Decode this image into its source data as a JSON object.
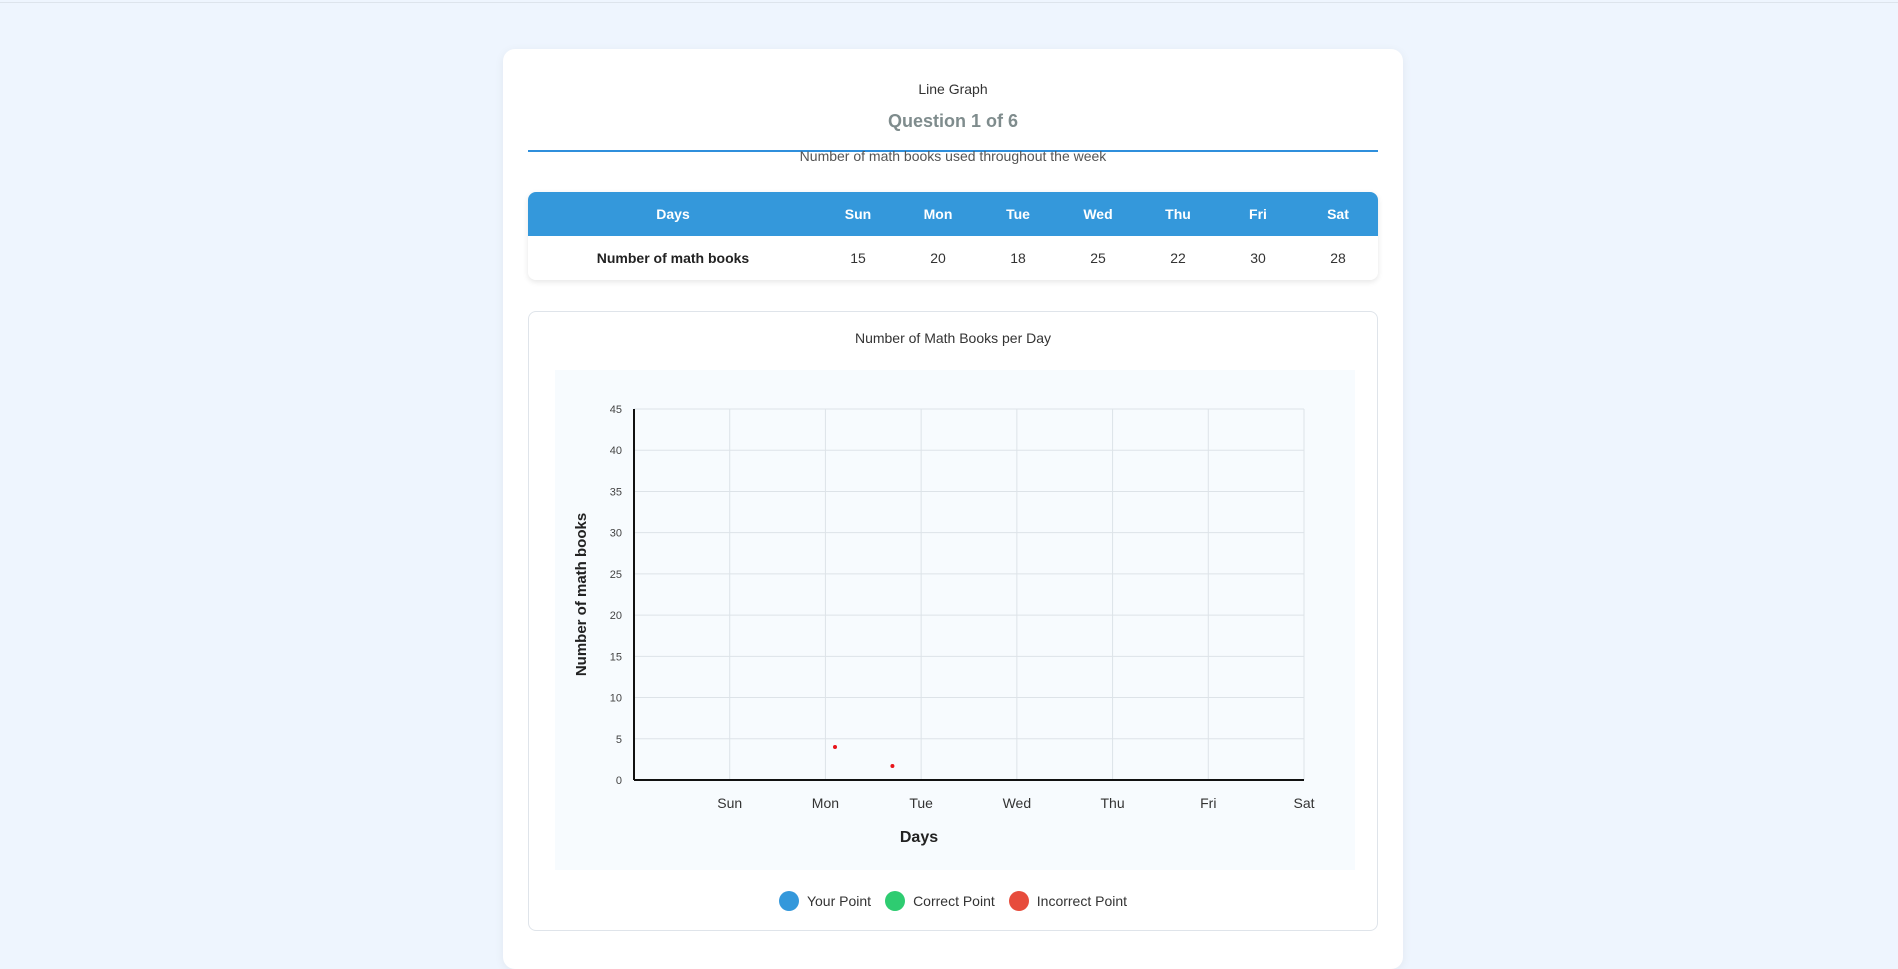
{
  "tab": {
    "label": "Line Graph"
  },
  "question": {
    "counter": "Question 1 of 6",
    "prompt": "Number of math books used throughout the week"
  },
  "table": {
    "header_label": "Days",
    "row_label": "Number of math books",
    "days": [
      "Sun",
      "Mon",
      "Tue",
      "Wed",
      "Thu",
      "Fri",
      "Sat"
    ],
    "values": [
      "15",
      "20",
      "18",
      "25",
      "22",
      "30",
      "28"
    ]
  },
  "graph": {
    "title": "Number of Math Books per Day",
    "legend": [
      {
        "label": "Your Point",
        "color": "#3498db"
      },
      {
        "label": "Correct Point",
        "color": "#2ecc71"
      },
      {
        "label": "Incorrect Point",
        "color": "#e74c3c"
      }
    ]
  },
  "chart_data": {
    "type": "scatter",
    "title": "Number of Math Books per Day",
    "xlabel": "Days",
    "ylabel": "Number of math books",
    "categories": [
      "",
      "Sun",
      "Mon",
      "Tue",
      "Wed",
      "Thu",
      "Fri",
      "Sat"
    ],
    "ylim": [
      0,
      45
    ],
    "yticks": [
      0,
      5,
      10,
      15,
      20,
      25,
      30,
      35,
      40,
      45
    ],
    "grid": true,
    "legend_position": "bottom",
    "points": [
      {
        "x": 2.1,
        "y": 4,
        "color": "#e8141a"
      },
      {
        "x": 2.7,
        "y": 1.7,
        "color": "#e8141a"
      }
    ]
  }
}
